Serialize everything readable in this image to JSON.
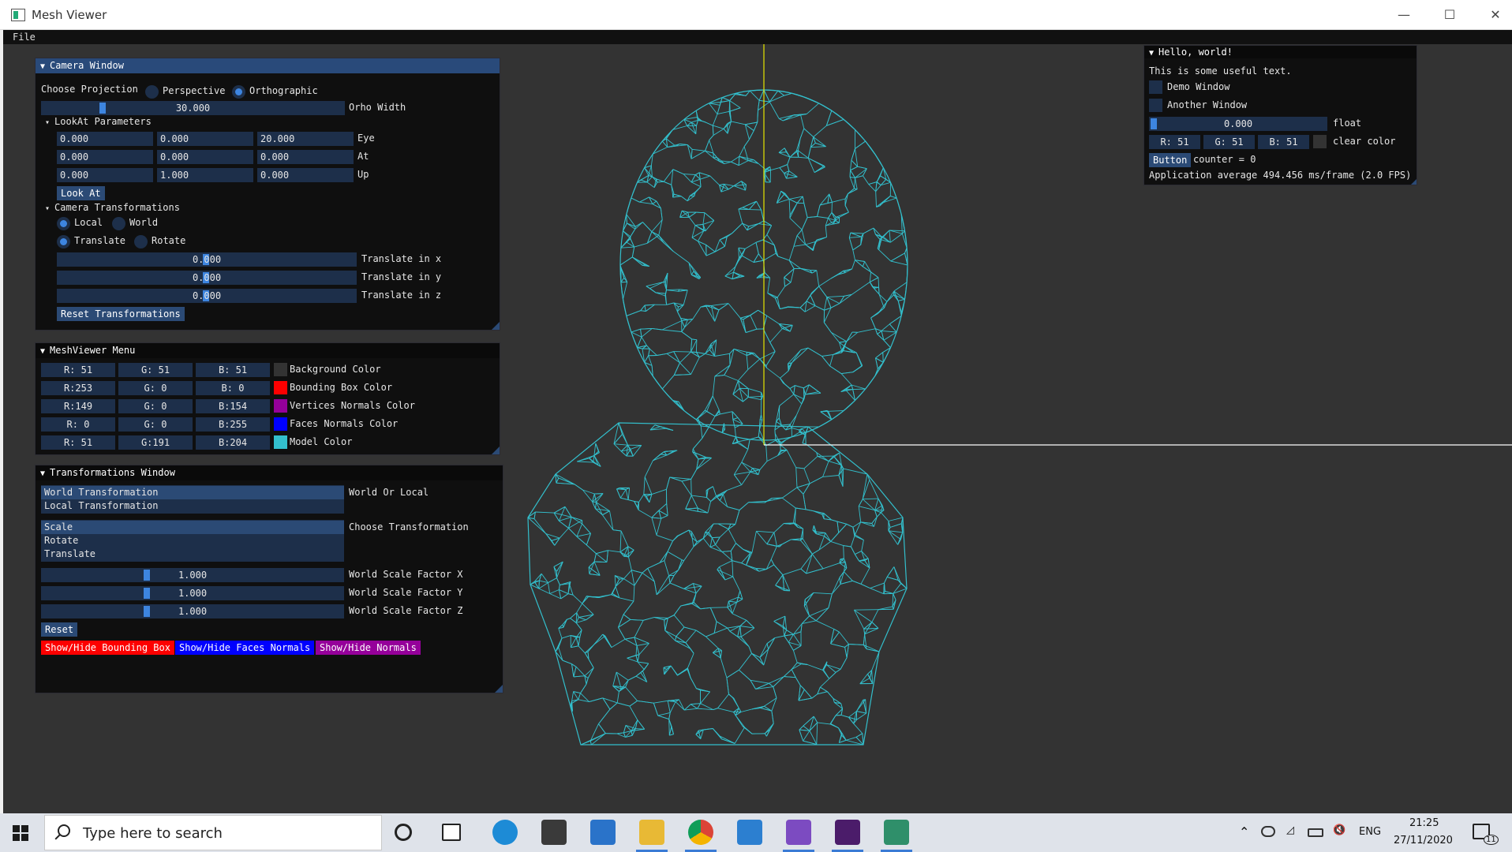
{
  "window": {
    "title": "Mesh Viewer",
    "minimize": "—",
    "maximize": "☐",
    "close": "✕"
  },
  "menu": {
    "file": "File"
  },
  "camera_window": {
    "title": "Camera Window",
    "projection_label": "Choose Projection",
    "perspective": "Perspective",
    "orthographic": "Orthographic",
    "ortho_width_value": "30.000",
    "ortho_width_label": "Orho Width",
    "lookat_header": "LookAt Parameters",
    "eye": [
      "0.000",
      "0.000",
      "20.000"
    ],
    "eye_label": "Eye",
    "at": [
      "0.000",
      "0.000",
      "0.000"
    ],
    "at_label": "At",
    "up": [
      "0.000",
      "1.000",
      "0.000"
    ],
    "up_label": "Up",
    "look_at_button": "Look At",
    "transforms_header": "Camera Transformations",
    "local": "Local",
    "world": "World",
    "translate": "Translate",
    "rotate": "Rotate",
    "tx_value": "0.000",
    "tx_label": "Translate in x",
    "ty_value": "0.000",
    "ty_label": "Translate in y",
    "tz_value": "0.000",
    "tz_label": "Translate in z",
    "reset_button": "Reset Transformations"
  },
  "meshviewer_menu": {
    "title": "MeshViewer Menu",
    "rows": [
      {
        "r": "R: 51",
        "g": "G: 51",
        "b": "B: 51",
        "color": "#333333",
        "label": "Background Color"
      },
      {
        "r": "R:253",
        "g": "G:  0",
        "b": "B:  0",
        "color": "#fd0000",
        "label": "Bounding Box Color"
      },
      {
        "r": "R:149",
        "g": "G:  0",
        "b": "B:154",
        "color": "#95009a",
        "label": "Vertices Normals Color"
      },
      {
        "r": "R:  0",
        "g": "G:  0",
        "b": "B:255",
        "color": "#0000ff",
        "label": "Faces Normals Color"
      },
      {
        "r": "R: 51",
        "g": "G:191",
        "b": "B:204",
        "color": "#33bfcc",
        "label": "Model Color"
      }
    ]
  },
  "transformations_window": {
    "title": "Transformations Window",
    "space_options": [
      "World Transformation",
      "Local Transformation"
    ],
    "space_label": "World Or Local",
    "type_options": [
      "Scale",
      "Rotate",
      "Translate"
    ],
    "type_label": "Choose Transformation",
    "sx_value": "1.000",
    "sx_label": "World Scale Factor X",
    "sy_value": "1.000",
    "sy_label": "World Scale Factor Y",
    "sz_value": "1.000",
    "sz_label": "World Scale Factor Z",
    "reset_button": "Reset",
    "toggle_bbox": "Show/Hide Bounding Box",
    "toggle_faces": "Show/Hide Faces Normals",
    "toggle_normals": "Show/Hide Normals"
  },
  "hello_window": {
    "title": "Hello, world!",
    "text": "This is some useful text.",
    "demo_window": "Demo Window",
    "another_window": "Another Window",
    "float_value": "0.000",
    "float_label": "float",
    "r": "R: 51",
    "g": "G: 51",
    "b": "B: 51",
    "clear_color_label": "clear color",
    "button": "Button",
    "counter": "counter = 0",
    "fps": "Application average 494.456 ms/frame (2.0 FPS)"
  },
  "colors": {
    "model": "#33bfcc",
    "axis_y": "#e6e600",
    "axis_x": "#ffffff",
    "accent": "#3d85e0",
    "title_active": "#294a7a"
  },
  "taskbar": {
    "search_placeholder": "Type here to search",
    "language": "ENG",
    "time": "21:25",
    "date": "27/11/2020",
    "notifications": "11"
  }
}
